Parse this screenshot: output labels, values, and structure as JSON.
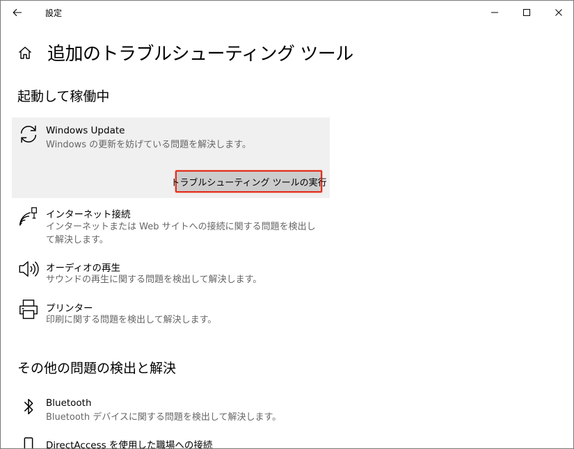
{
  "window": {
    "app_title": "設定"
  },
  "page": {
    "title": "追加のトラブルシューティング ツール"
  },
  "sections": {
    "running": {
      "heading": "起動して稼働中"
    },
    "other": {
      "heading": "その他の問題の検出と解決"
    }
  },
  "items": {
    "windows_update": {
      "title": "Windows Update",
      "desc": "Windows の更新を妨げている問題を解決します。",
      "run_label": "トラブルシューティング ツールの実行",
      "icon": "sync-icon"
    },
    "internet": {
      "title": "インターネット接続",
      "desc": "インターネットまたは Web サイトへの接続に関する問題を検出して解決します。",
      "icon": "network-icon"
    },
    "audio": {
      "title": "オーディオの再生",
      "desc": "サウンドの再生に関する問題を検出して解決します。",
      "icon": "speaker-icon"
    },
    "printer": {
      "title": "プリンター",
      "desc": "印刷に関する問題を検出して解決します。",
      "icon": "printer-icon"
    },
    "bluetooth": {
      "title": "Bluetooth",
      "desc": "Bluetooth デバイスに関する問題を検出して解決します。",
      "icon": "bluetooth-icon"
    },
    "directaccess": {
      "title": "DirectAccess を使用した職場への接続",
      "icon": "phone-icon"
    }
  },
  "colors": {
    "highlight_border": "#e0301e",
    "button_bg": "#cccccc",
    "selected_bg": "#f0f0f0"
  }
}
